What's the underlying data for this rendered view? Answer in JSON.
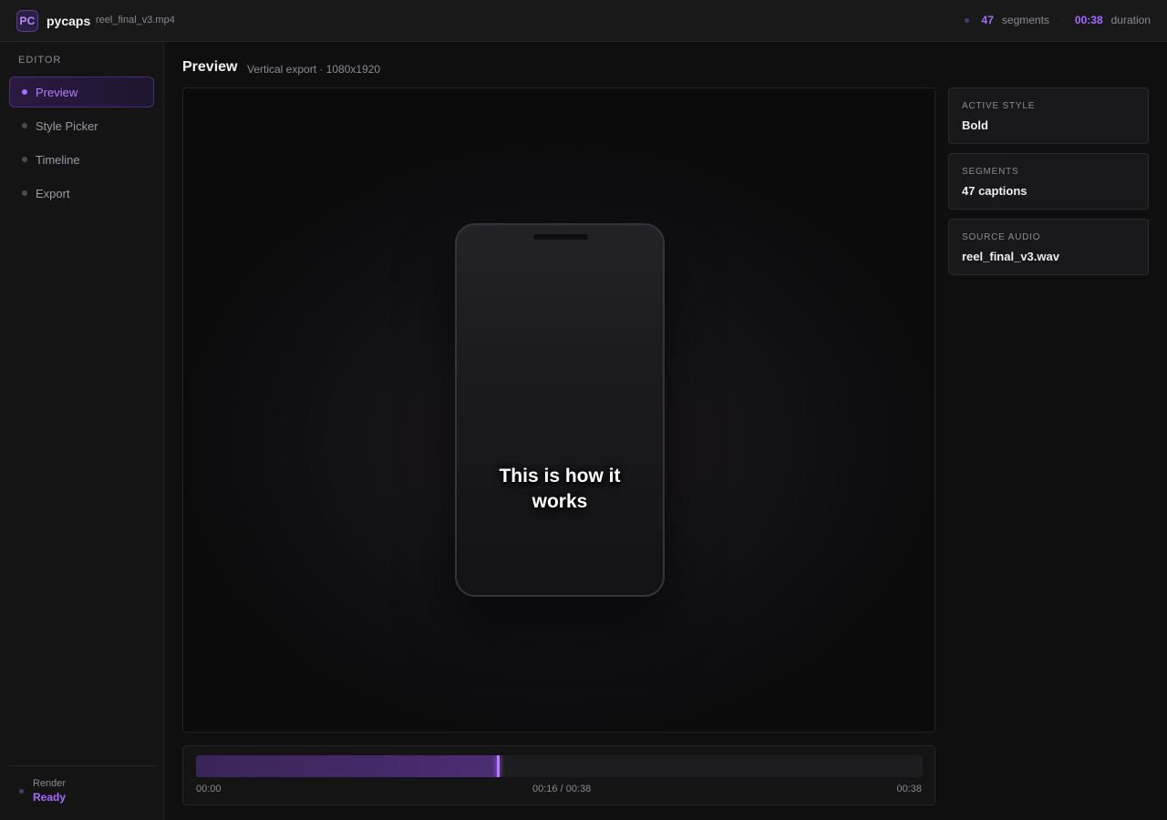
{
  "header": {
    "logo": "PC",
    "app_name": "pycaps",
    "file_name": "reel_final_v3.mp4",
    "segments_count": "47",
    "segments_label": "segments",
    "separator": "·",
    "duration_value": "00:38",
    "duration_label": "duration"
  },
  "sidebar": {
    "section_title": "EDITOR",
    "items": [
      {
        "label": "Preview",
        "active": true
      },
      {
        "label": "Style Picker",
        "active": false
      },
      {
        "label": "Timeline",
        "active": false
      },
      {
        "label": "Export",
        "active": false
      }
    ],
    "render_label": "Render",
    "render_status": "Ready"
  },
  "main": {
    "title": "Preview",
    "subtitle": "Vertical export · 1080x1920",
    "caption": "This is how it works"
  },
  "info_cards": [
    {
      "label": "ACTIVE STYLE",
      "value": "Bold"
    },
    {
      "label": "SEGMENTS",
      "value": "47 captions"
    },
    {
      "label": "SOURCE AUDIO",
      "value": "reel_final_v3.wav"
    }
  ],
  "timeline": {
    "start": "00:00",
    "current": "00:16 / 00:38",
    "end": "00:38",
    "progress": 0.415
  },
  "colors": {
    "accent": "#a56cff",
    "background": "#0f0f10"
  }
}
